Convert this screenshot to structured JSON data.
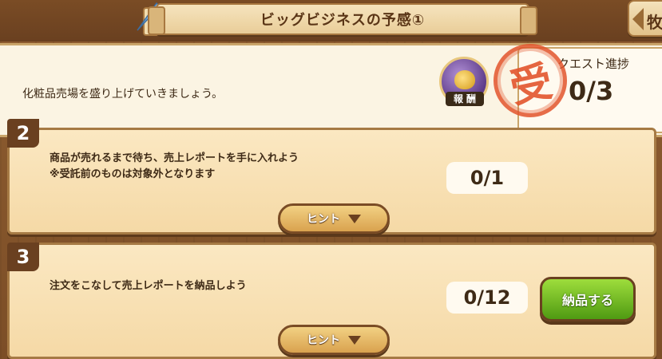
{
  "header": {
    "title": "ビッグビジネスの予感①",
    "collect_tab_label": "牧"
  },
  "quest": {
    "description": "化粧品売場を盛り上げていきましょう。",
    "reward_label": "報酬",
    "progress_label": "クエスト進捗",
    "progress_value": "0/3",
    "stamp_char": "受"
  },
  "tasks": [
    {
      "number": "2",
      "text_line1": "商品が売れるまで待ち、売上レポートを手に入れよう",
      "text_line2": "※受託前のものは対象外となります",
      "count": "0/1",
      "hint_label": "ヒント"
    },
    {
      "number": "3",
      "text_line1": "注文をこなして売上レポートを納品しよう",
      "count": "0/12",
      "hint_label": "ヒント",
      "action_label": "納品する"
    }
  ]
}
